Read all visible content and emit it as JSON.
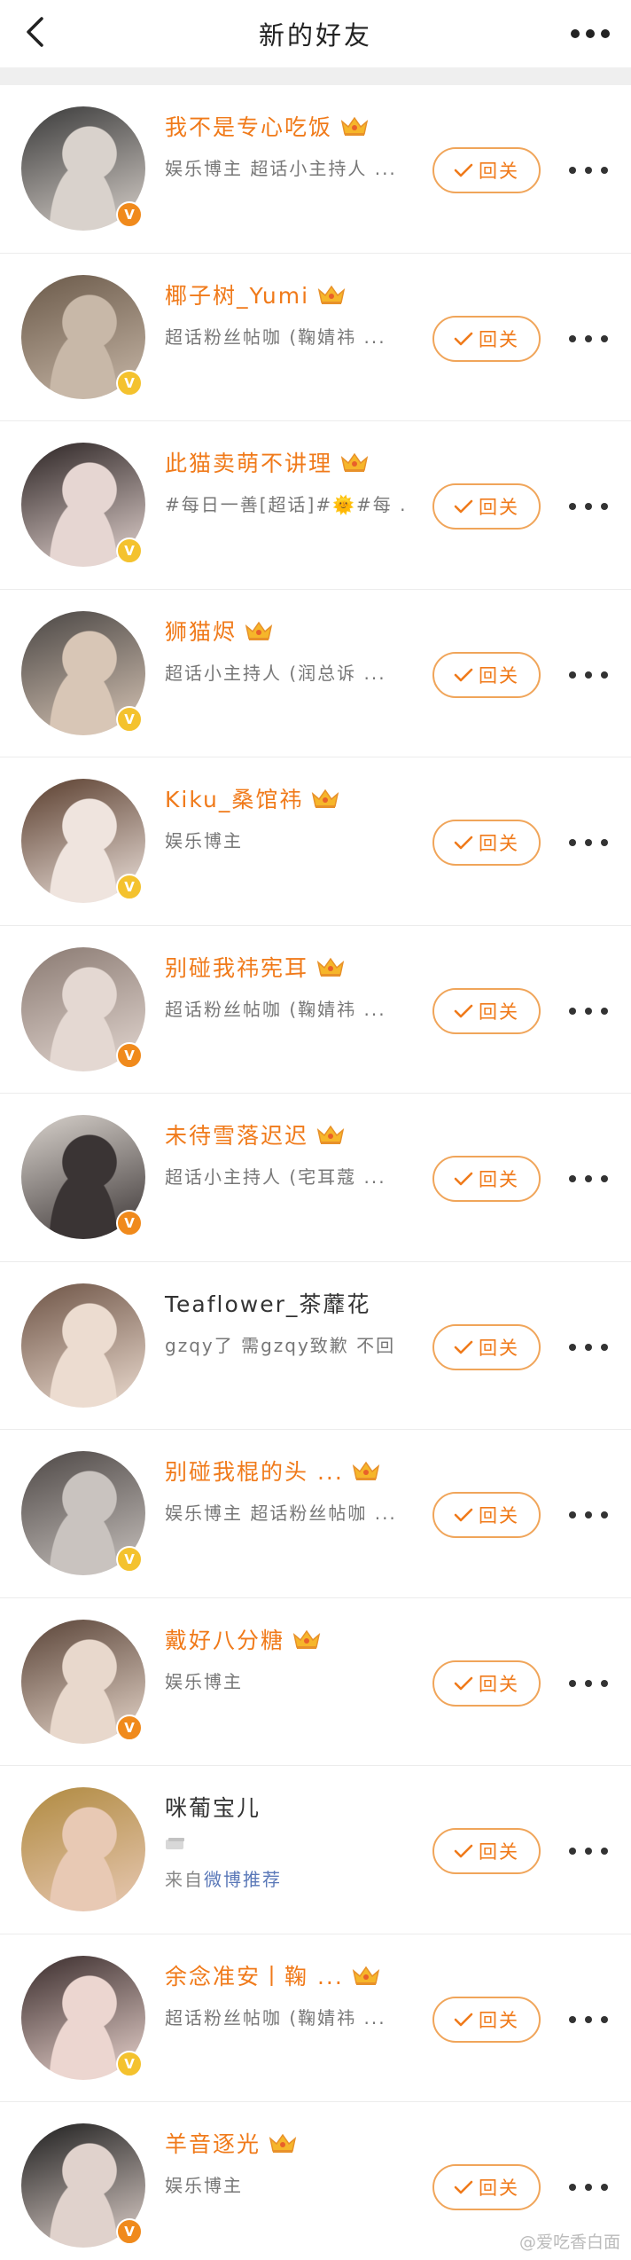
{
  "header": {
    "title": "新的好友"
  },
  "follow_label": "回关",
  "watermark": "@爱吃香白面",
  "rows": [
    {
      "name": "我不是专心吃饭",
      "desc": "娱乐博主 超话小主持人 ...",
      "badge": "orange",
      "crown": true,
      "colors": [
        "#3a3a3a",
        "#d9d2cc"
      ]
    },
    {
      "name": "椰子树_Yumi",
      "desc": "超话粉丝帖咖 (鞠婧祎 ...",
      "badge": "gold",
      "crown": true,
      "colors": [
        "#6b5a4a",
        "#c8b8a8"
      ]
    },
    {
      "name": "此猫卖萌不讲理",
      "desc": "#每日一善[超话]#🌞#每 ...",
      "badge": "gold",
      "crown": true,
      "colors": [
        "#2c2424",
        "#e6d6d2"
      ]
    },
    {
      "name": "狮猫烬",
      "desc": "超话小主持人 (润总诉 ...",
      "badge": "gold",
      "crown": true,
      "colors": [
        "#4a4644",
        "#d8c6b6"
      ]
    },
    {
      "name": "Kiku_桑馆祎",
      "desc": "娱乐博主",
      "badge": "gold",
      "crown": true,
      "colors": [
        "#5a3e2e",
        "#efe4de"
      ]
    },
    {
      "name": "别碰我祎宪耳",
      "desc": "超话粉丝帖咖 (鞠婧祎 ...",
      "badge": "orange",
      "crown": true,
      "colors": [
        "#8a7a72",
        "#e4d8d2"
      ]
    },
    {
      "name": "未待雪落迟迟",
      "desc": "超话小主持人 (宅耳蔻 ...",
      "badge": "orange",
      "crown": true,
      "colors": [
        "#d8d2cc",
        "#3a3434"
      ]
    },
    {
      "name": "Teaflower_茶蘼花",
      "desc": "gzqy了 需gzqy致歉 不回 ...",
      "badge": "",
      "crown": false,
      "plain": true,
      "colors": [
        "#6e5446",
        "#ecdcd0"
      ]
    },
    {
      "name": "别碰我棍的头 ...",
      "desc": "娱乐博主 超话粉丝帖咖 ...",
      "badge": "gold",
      "crown": true,
      "colors": [
        "#4e4846",
        "#c9c3bf"
      ]
    },
    {
      "name": "戴好八分糖",
      "desc": "娱乐博主",
      "badge": "orange",
      "crown": true,
      "colors": [
        "#5a4438",
        "#e8d8cc"
      ]
    },
    {
      "name": "咪葡宝儿",
      "desc": "",
      "from_prefix": "来自",
      "from_link": "微博推荐",
      "badge": "",
      "crown": false,
      "plain": true,
      "card": true,
      "colors": [
        "#b08a40",
        "#e8c9b4"
      ]
    },
    {
      "name": "余念准安丨鞠 ...",
      "desc": "超话粉丝帖咖 (鞠婧祎 ...",
      "badge": "gold",
      "crown": true,
      "colors": [
        "#3a2c2c",
        "#ecd6d0"
      ]
    },
    {
      "name": "羊音逐光",
      "desc": "娱乐博主",
      "badge": "orange",
      "crown": true,
      "colors": [
        "#1e1e1e",
        "#e0d2cc"
      ]
    }
  ]
}
